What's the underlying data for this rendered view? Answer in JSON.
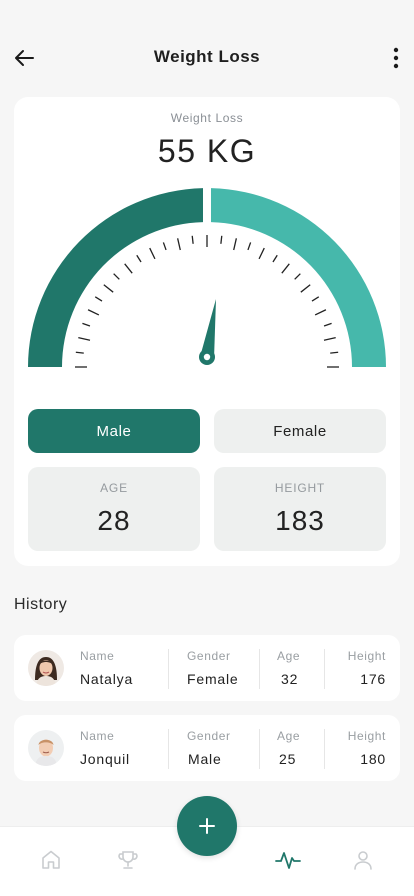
{
  "header": {
    "title": "Weight Loss",
    "back_icon": "arrow-left-icon",
    "more_icon": "more-vertical-icon"
  },
  "calculator": {
    "label": "Weight Loss",
    "value": "55 KG",
    "gauge": {
      "min_color": "#20776a",
      "max_color": "#46b8ab",
      "tick_color": "#222222",
      "needle_fraction": 0.52
    },
    "gender_male": "Male",
    "gender_female": "Female",
    "selected_gender": "Male",
    "age_label": "AGE",
    "age_value": "28",
    "height_label": "HEIGHT",
    "height_value": "183"
  },
  "history": {
    "title": "History",
    "columns": {
      "name": "Name",
      "gender": "Gender",
      "age": "Age",
      "height": "Height"
    },
    "rows": [
      {
        "name": "Natalya",
        "gender": "Female",
        "age": "32",
        "height": "176",
        "avatar": "female-avatar"
      },
      {
        "name": "Jonquil",
        "gender": "Male",
        "age": "25",
        "height": "180",
        "avatar": "male-avatar"
      }
    ]
  },
  "nav": {
    "items": [
      "home-icon",
      "trophy-icon",
      "activity-icon",
      "profile-icon"
    ],
    "active": "activity-icon",
    "fab_icon": "plus-icon"
  },
  "colors": {
    "accent": "#20776a",
    "accent_light": "#46b8ab",
    "surface": "#ffffff",
    "background": "#f6f6f6"
  }
}
